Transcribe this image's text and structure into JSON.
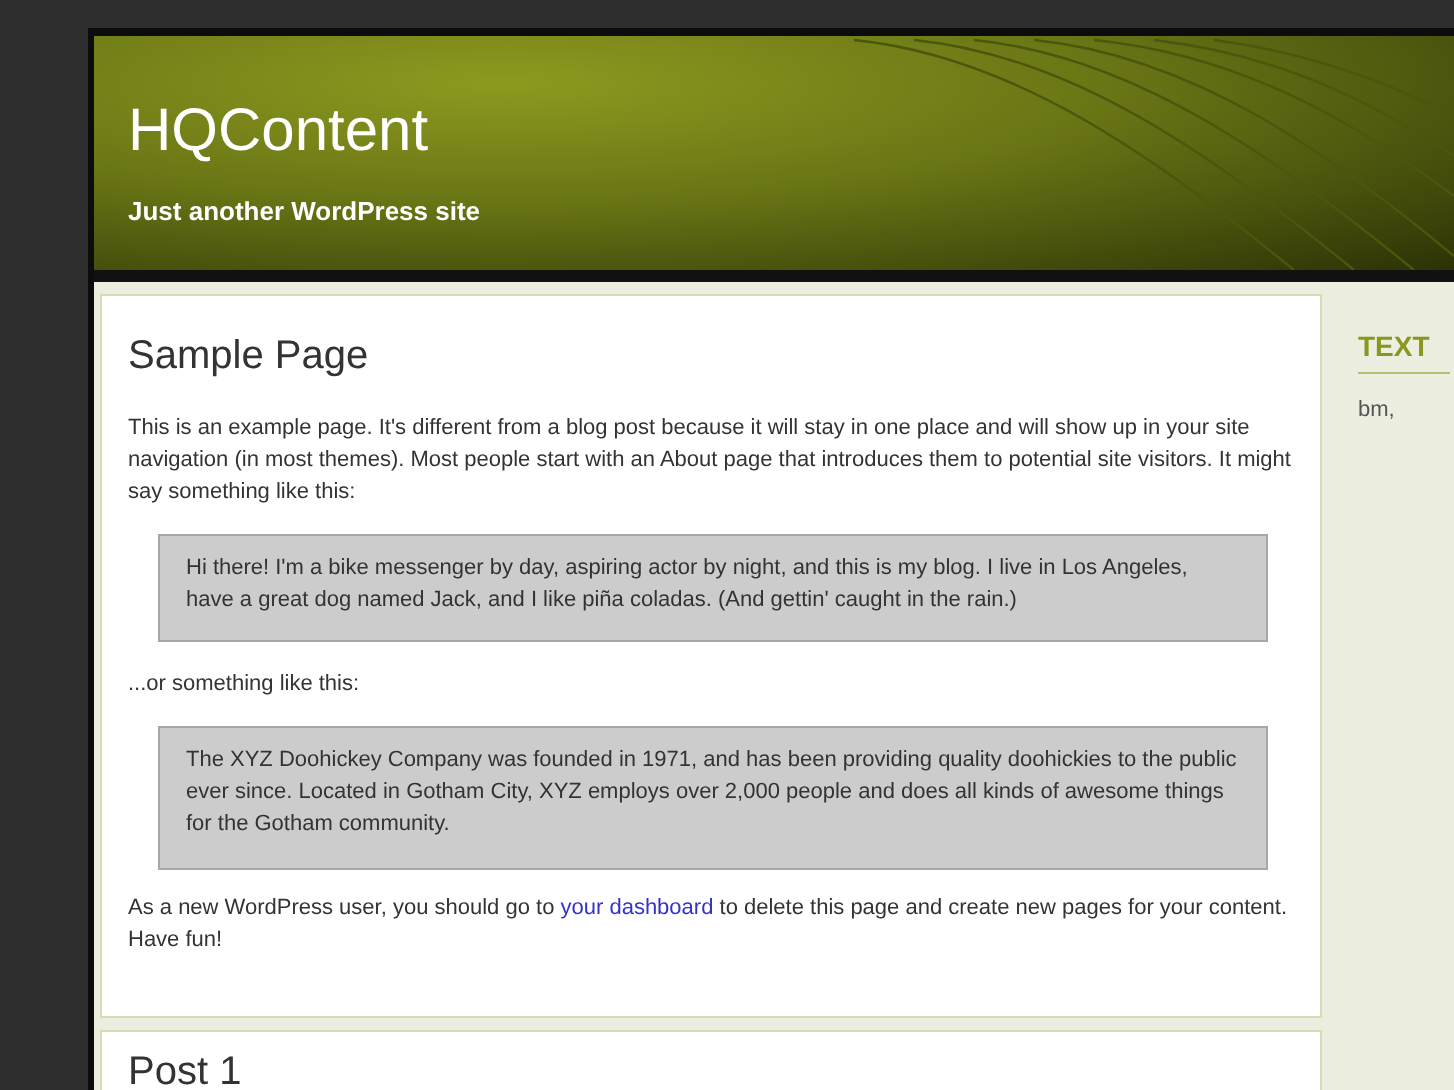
{
  "header": {
    "site_title": "HQContent",
    "tagline": "Just another WordPress site"
  },
  "page": {
    "title": "Sample Page",
    "intro": "This is an example page. It's different from a blog post because it will stay in one place and will show up in your site navigation (in most themes). Most people start with an About page that introduces them to potential site visitors. It might say something like this:",
    "quote_1": "Hi there! I'm a bike messenger by day, aspiring actor by night, and this is my blog. I live in Los Angeles, have a great dog named Jack, and I like piña coladas. (And gettin' caught in the rain.)",
    "middle": "...or something like this:",
    "quote_2": "The XYZ Doohickey Company was founded in 1971, and has been providing quality doohickies to the public ever since. Located in Gotham City, XYZ employs over 2,000 people and does all kinds of awesome things for the Gotham community.",
    "closing": [
      {
        "kind": "text",
        "text": "As a new WordPress user, you should go to "
      },
      {
        "kind": "link",
        "text": "your dashboard"
      },
      {
        "kind": "text",
        "text": " to delete this page and create new pages for your content. Have fun!"
      }
    ]
  },
  "next_post": {
    "title": "Post 1"
  },
  "sidebar": {
    "widget_title": "TEXT",
    "widget_text": "bm,"
  }
}
